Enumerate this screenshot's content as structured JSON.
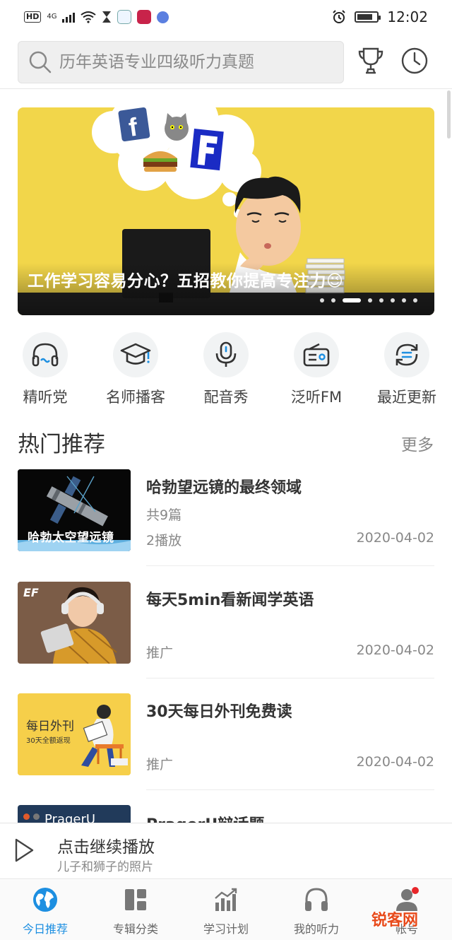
{
  "status_bar": {
    "hd": "HD",
    "network": "4G",
    "time": "12:02",
    "battery_level": 0.8
  },
  "search": {
    "placeholder": "历年英语专业四级听力真题"
  },
  "banner": {
    "caption": "工作学习容易分心？五招教你提高专注力😉",
    "dot_count": 8,
    "active_dot": 2
  },
  "categories": [
    {
      "label": "精听党",
      "icon": "headphones-icon"
    },
    {
      "label": "名师播客",
      "icon": "graduation-cap-icon"
    },
    {
      "label": "配音秀",
      "icon": "microphone-icon"
    },
    {
      "label": "泛听FM",
      "icon": "radio-icon"
    },
    {
      "label": "最近更新",
      "icon": "refresh-icon"
    }
  ],
  "hot": {
    "title": "热门推荐",
    "more": "更多",
    "items": [
      {
        "title": "哈勃望远镜的最终领域",
        "count": "共9篇",
        "plays": "2播放",
        "date": "2020-04-02",
        "thumb_text": "哈勃太空望远镜"
      },
      {
        "title": "每天5min看新闻学英语",
        "count": "",
        "plays": "推广",
        "date": "2020-04-02",
        "thumb_text": "EF"
      },
      {
        "title": "30天每日外刊免费读",
        "count": "",
        "plays": "推广",
        "date": "2020-04-02",
        "thumb_text": "每日外刊",
        "thumb_sub": "30天全额返现"
      },
      {
        "title": "PragerU辩话题",
        "count": "",
        "plays": "",
        "date": "",
        "thumb_text": "PragerU"
      }
    ]
  },
  "player": {
    "title": "点击继续播放",
    "subtitle": "儿子和狮子的照片"
  },
  "tabs": [
    {
      "label": "今日推荐",
      "active": true
    },
    {
      "label": "专辑分类",
      "active": false
    },
    {
      "label": "学习计划",
      "active": false
    },
    {
      "label": "我的听力",
      "active": false
    },
    {
      "label": "帐号",
      "active": false
    }
  ],
  "watermark": "锐客网",
  "colors": {
    "accent": "#1d8fe1",
    "banner_bg": "#f2d64a",
    "badge_red": "#e8262a"
  }
}
